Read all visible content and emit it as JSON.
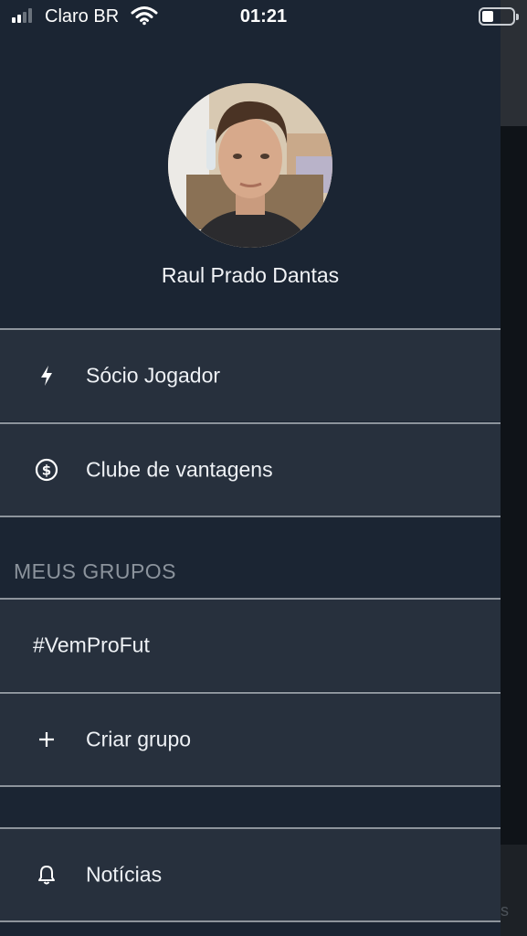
{
  "status_bar": {
    "carrier": "Claro BR",
    "time": "01:21",
    "signal_bars_active": 2,
    "signal_bars_total": 4,
    "battery_level_fraction": 0.3
  },
  "profile": {
    "name": "Raul Prado Dantas"
  },
  "menu": {
    "items": [
      {
        "label": "Sócio Jogador",
        "icon": "lightning-icon"
      },
      {
        "label": "Clube de vantagens",
        "icon": "dollar-circle-icon"
      }
    ]
  },
  "groups": {
    "section_title": "MEUS GRUPOS",
    "items": [
      {
        "label": "#VemProFut"
      },
      {
        "label": "Criar grupo",
        "icon": "plus-icon"
      }
    ]
  },
  "footer_menu": {
    "items": [
      {
        "label": "Notícias",
        "icon": "bell-icon"
      }
    ]
  },
  "background_app": {
    "partial_text": "s"
  },
  "colors": {
    "drawer_background": "#1b2533",
    "row_background": "#27303d",
    "divider": "#8d949c",
    "section_title": "#8b939c",
    "text": "#eef1f5"
  }
}
